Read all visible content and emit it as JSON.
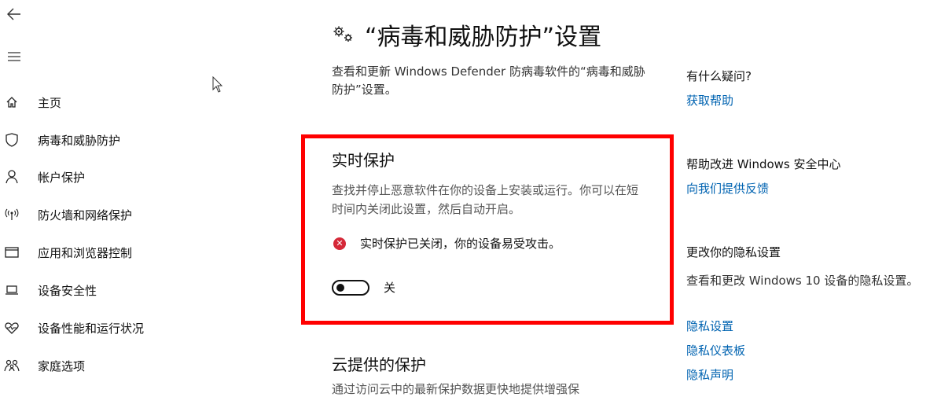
{
  "nav": {
    "back_icon": "arrow-left-icon",
    "menu_icon": "hamburger-icon",
    "items": [
      {
        "label": "主页",
        "icon": "home-icon"
      },
      {
        "label": "病毒和威胁防护",
        "icon": "shield-icon"
      },
      {
        "label": "帐户保护",
        "icon": "person-icon"
      },
      {
        "label": "防火墙和网络保护",
        "icon": "wifi-antenna-icon"
      },
      {
        "label": "应用和浏览器控制",
        "icon": "browser-window-icon"
      },
      {
        "label": "设备安全性",
        "icon": "laptop-icon"
      },
      {
        "label": "设备性能和运行状况",
        "icon": "heart-pulse-icon"
      },
      {
        "label": "家庭选项",
        "icon": "family-icon"
      }
    ]
  },
  "main": {
    "title": "“病毒和威胁防护”设置",
    "description": "查看和更新 Windows Defender 防病毒软件的“病毒和威胁防护”设置。",
    "realtime": {
      "title": "实时保护",
      "description": "查找并停止恶意软件在你的设备上安装或运行。你可以在短时间内关闭此设置，然后自动开启。",
      "status": "实时保护已关闭，你的设备易受攻击。",
      "toggle_label": "关",
      "toggle_on": false
    },
    "cloud": {
      "title": "云提供的保护",
      "description": "通过访问云中的最新保护数据更快地提供增强保"
    }
  },
  "side": {
    "question_heading": "有什么疑问?",
    "help_link": "获取帮助",
    "improve_heading": "帮助改进 Windows 安全中心",
    "feedback_link": "向我们提供反馈",
    "privacy_heading": "更改你的隐私设置",
    "privacy_text": "查看和更改 Windows 10 设备的隐私设置。",
    "privacy_links": [
      "隐私设置",
      "隐私仪表板",
      "隐私声明"
    ]
  },
  "colors": {
    "accent_link": "#0063b1",
    "highlight_border": "#ff0000",
    "error": "#d52838"
  }
}
